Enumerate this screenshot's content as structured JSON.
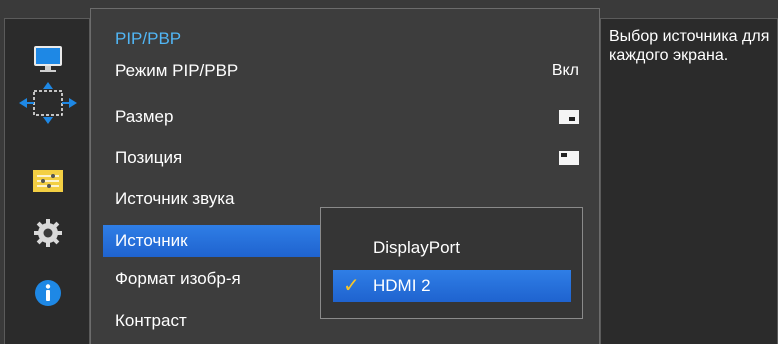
{
  "menu": {
    "title": "PIP/PBP",
    "items": [
      {
        "label": "Режим PIP/PBP",
        "value": "Вкл"
      },
      {
        "label": "Размер",
        "value": ""
      },
      {
        "label": "Позиция",
        "value": ""
      },
      {
        "label": "Источник звука",
        "value": ""
      },
      {
        "label": "Источник",
        "value": ""
      },
      {
        "label": "Формат изобр-я",
        "value": ""
      },
      {
        "label": "Контраст",
        "value": ""
      }
    ]
  },
  "source_dropdown": {
    "options": [
      "DisplayPort",
      "HDMI 2"
    ],
    "selected": "HDMI 2"
  },
  "description": "Выбор источника для каждого экрана.",
  "rail_icons": [
    "monitor-icon",
    "move-arrows-icon",
    "settings-sliders-icon",
    "gear-icon",
    "info-icon"
  ],
  "colors": {
    "accent": "#51b6f5",
    "selection": "#2f7ee6",
    "check": "#f7c52a"
  }
}
